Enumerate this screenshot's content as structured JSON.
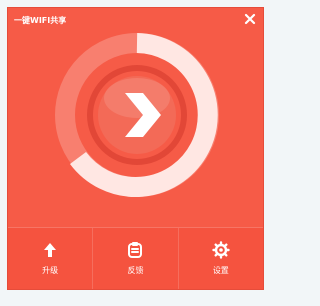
{
  "window": {
    "title": "一键WIFI共享"
  },
  "toolbar": [
    {
      "label": "升级",
      "icon": "upload-arrow-icon"
    },
    {
      "label": "反馈",
      "icon": "feedback-clipboard-icon"
    },
    {
      "label": "设置",
      "icon": "gear-icon"
    }
  ],
  "colors": {
    "background": "#f65b47",
    "accent": "#ffffff"
  }
}
